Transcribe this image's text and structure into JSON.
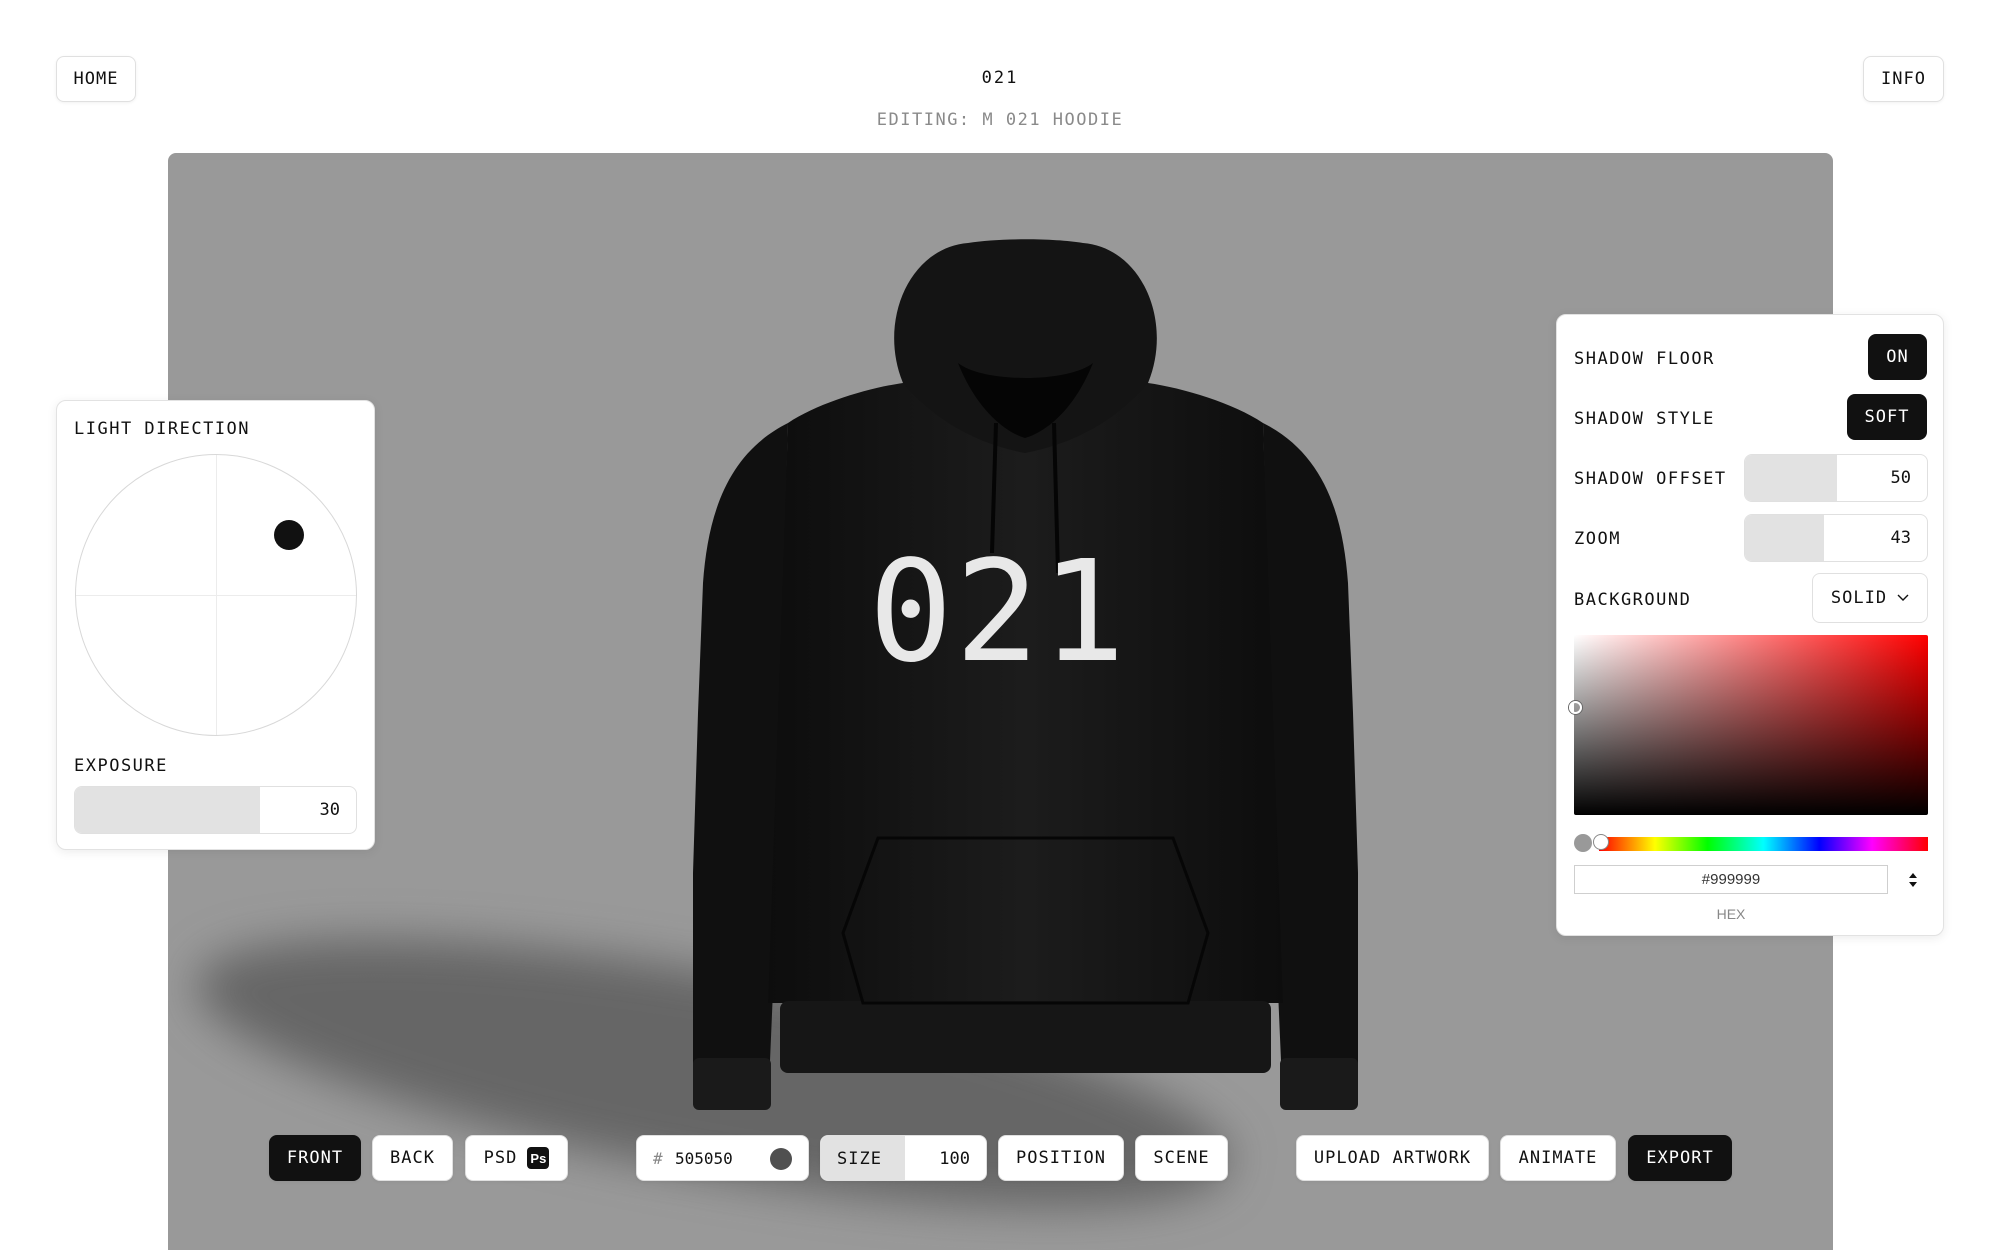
{
  "header": {
    "home_label": "HOME",
    "info_label": "INFO",
    "title": "021",
    "subtitle": "EDITING: M 021 HOODIE"
  },
  "garment": {
    "print_text": "021",
    "color_hex": "#111111"
  },
  "light_panel": {
    "title": "LIGHT DIRECTION",
    "exposure_label": "EXPOSURE",
    "exposure_value": "30",
    "exposure_fraction": 0.66
  },
  "scene_panel": {
    "shadow_floor_label": "SHADOW FLOOR",
    "shadow_floor_value": "ON",
    "shadow_style_label": "SHADOW STYLE",
    "shadow_style_value": "SOFT",
    "shadow_offset_label": "SHADOW OFFSET",
    "shadow_offset_value": "50",
    "shadow_offset_fraction": 0.5,
    "zoom_label": "ZOOM",
    "zoom_value": "43",
    "zoom_fraction": 0.43,
    "background_label": "BACKGROUND",
    "background_mode": "SOLID",
    "hex_value": "#999999",
    "hex_label": "HEX"
  },
  "toolbar": {
    "front_label": "FRONT",
    "back_label": "BACK",
    "psd_label": "PSD",
    "ps_badge": "Ps",
    "color_hash": "#",
    "color_hex": "505050",
    "size_label": "SIZE",
    "size_value": "100",
    "position_label": "POSITION",
    "scene_label": "SCENE",
    "upload_label": "UPLOAD ARTWORK",
    "animate_label": "ANIMATE",
    "export_label": "EXPORT"
  },
  "colors": {
    "stage_background": "#999999",
    "accent_dark": "#111111",
    "garment_color": "#505050"
  }
}
